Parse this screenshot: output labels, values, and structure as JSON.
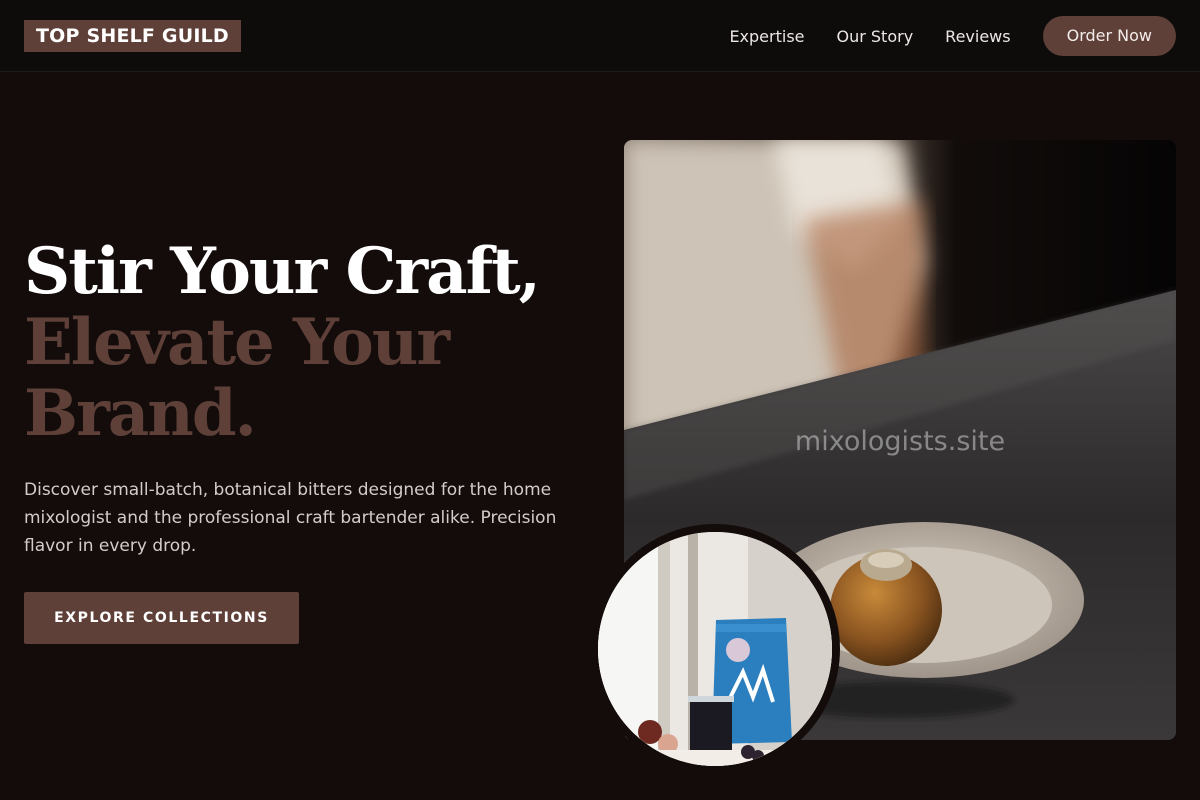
{
  "nav": {
    "logo": "TOP SHELF GUILD",
    "links": [
      "Expertise",
      "Our Story",
      "Reviews"
    ],
    "cta": "Order Now"
  },
  "hero": {
    "title_line1": "Stir Your Craft,",
    "title_line2": "Elevate Your",
    "title_line3": "Brand.",
    "description": "Discover small-batch, botanical bitters designed for the home mixologist and the professional craft bartender alike. Precision flavor in every drop.",
    "button": "EXPLORE COLLECTIONS"
  },
  "images": {
    "main_watermark": "mixologists.site"
  },
  "colors": {
    "background": "#130c0b",
    "accent": "#5e4038",
    "text": "#ffffff"
  }
}
